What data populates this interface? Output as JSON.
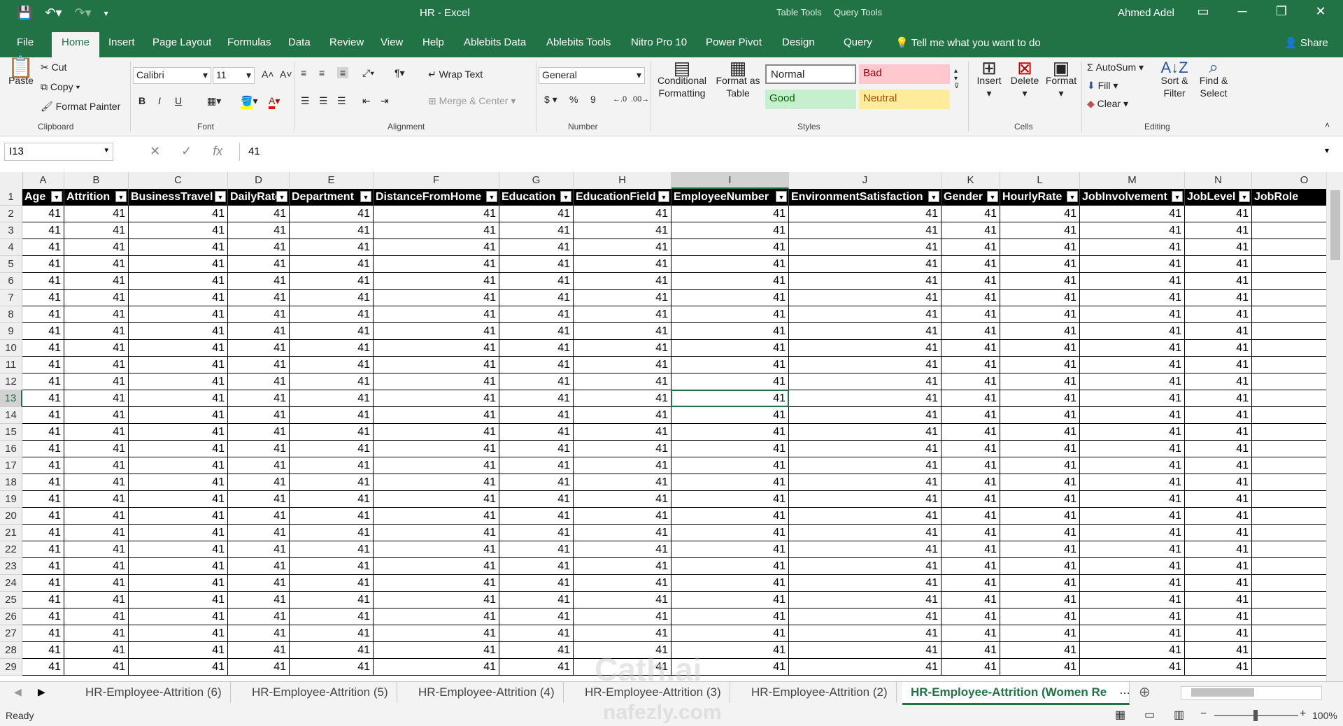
{
  "window": {
    "title": "HR  -  Excel",
    "user": "Ahmed Adel",
    "context_tabs": [
      "Table Tools",
      "Query Tools"
    ]
  },
  "ribbon_tabs": [
    "File",
    "Home",
    "Insert",
    "Page Layout",
    "Formulas",
    "Data",
    "Review",
    "View",
    "Help",
    "Ablebits Data",
    "Ablebits Tools",
    "Nitro Pro 10",
    "Power Pivot",
    "Design",
    "Query"
  ],
  "active_tab": "Home",
  "tell_me": "Tell me what you want to do",
  "share": "Share",
  "clipboard": {
    "paste": "Paste",
    "cut": "Cut",
    "copy": "Copy",
    "format_painter": "Format Painter",
    "label": "Clipboard"
  },
  "font": {
    "name": "Calibri",
    "size": "11",
    "label": "Font",
    "bold": "B",
    "italic": "I",
    "underline": "U"
  },
  "alignment": {
    "wrap_text": "Wrap Text",
    "merge_center": "Merge & Center",
    "label": "Alignment"
  },
  "number": {
    "format": "General",
    "label": "Number",
    "currency": "$",
    "percent": "%",
    "comma": "9"
  },
  "styles": {
    "conditional": "Conditional Formatting",
    "format_table": "Format as Table",
    "normal": "Normal",
    "bad": "Bad",
    "good": "Good",
    "neutral": "Neutral",
    "label": "Styles",
    "colors": {
      "normal": "#ffffff",
      "bad": "#ffc7ce",
      "bad_text": "#9c0006",
      "good": "#c6efce",
      "good_text": "#006100",
      "neutral": "#ffeb9c",
      "neutral_text": "#9c5700"
    }
  },
  "cells": {
    "insert": "Insert",
    "delete": "Delete",
    "format": "Format",
    "label": "Cells"
  },
  "editing": {
    "autosum": "AutoSum",
    "fill": "Fill",
    "clear": "Clear",
    "sort": "Sort & Filter",
    "find": "Find & Select",
    "label": "Editing"
  },
  "formula_bar": {
    "name_box": "I13",
    "value": "41"
  },
  "sheet": {
    "columns": [
      "A",
      "B",
      "C",
      "D",
      "E",
      "F",
      "G",
      "H",
      "I",
      "J",
      "K",
      "L",
      "M",
      "N",
      "O"
    ],
    "headers": [
      "Age",
      "Attrition",
      "BusinessTravel",
      "DailyRate",
      "Department",
      "DistanceFromHome",
      "Education",
      "EducationField",
      "EmployeeNumber",
      "EnvironmentSatisfaction",
      "Gender",
      "HourlyRate",
      "JobInvolvement",
      "JobLevel",
      "JobRole"
    ],
    "row_numbers": [
      "1",
      "2",
      "3",
      "4",
      "5",
      "6",
      "7",
      "8",
      "9",
      "10",
      "11",
      "12",
      "13",
      "14",
      "15",
      "16",
      "17",
      "18",
      "19",
      "20",
      "21",
      "22",
      "23",
      "24",
      "25",
      "26",
      "27",
      "28",
      "29"
    ],
    "cell_value": "41",
    "selected_column": "I",
    "selected_row": "13"
  },
  "sheet_tabs": [
    "HR-Employee-Attrition (6)",
    "HR-Employee-Attrition (5)",
    "HR-Employee-Attrition (4)",
    "HR-Employee-Attrition (3)",
    "HR-Employee-Attrition (2)",
    "HR-Employee-Attrition (Women Re"
  ],
  "active_sheet": "HR-Employee-Attrition (Women Re",
  "status": {
    "ready": "Ready",
    "zoom": "100%"
  },
  "watermark": {
    "line1": "Cath.ai",
    "line2": "nafezly.com"
  },
  "accent": "#217346"
}
